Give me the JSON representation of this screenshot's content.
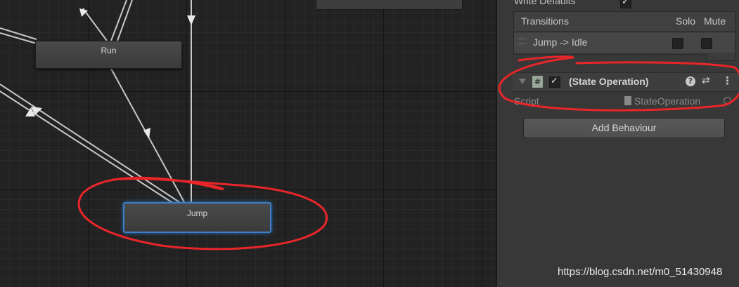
{
  "graph": {
    "states": [
      {
        "id": "run",
        "label": "Run"
      },
      {
        "id": "jump",
        "label": "Jump"
      }
    ]
  },
  "inspector": {
    "write_defaults_label": "Write Defaults",
    "transitions": {
      "header": "Transitions",
      "solo": "Solo",
      "mute": "Mute",
      "items": [
        "Jump -> Idle"
      ]
    },
    "behaviour": {
      "title": "(State Operation)",
      "script_label": "Script",
      "script_value": "StateOperation"
    },
    "add_behaviour": "Add Behaviour"
  },
  "watermark": "https://blog.csdn.net/m0_51430948",
  "colors": {
    "annotation": "#e8262a",
    "selected_outline": "#3c7fc6"
  }
}
